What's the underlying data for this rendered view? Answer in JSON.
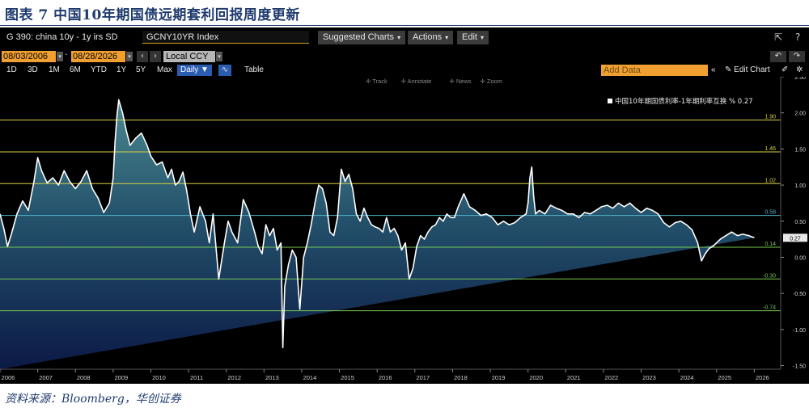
{
  "caption": "图表 7 中国10年期国债远期套利回报周度更新",
  "source": "资料来源：Bloomberg，华创证券",
  "toolbar": {
    "ticker": "G 390: china 10y - 1y irs SD",
    "security": "GCNY10YR Index",
    "suggested_charts": "Suggested Charts",
    "actions": "Actions",
    "edit": "Edit",
    "export_icon": "export-icon",
    "help_icon": "help-icon"
  },
  "range": {
    "start_date": "08/03/2006",
    "end_date": "08/28/2026",
    "currency": "Local CCY"
  },
  "periods": [
    "1D",
    "3D",
    "1M",
    "6M",
    "YTD",
    "1Y",
    "5Y",
    "Max"
  ],
  "frequency": "Daily",
  "table_label": "Table",
  "add_data_placeholder": "Add Data",
  "edit_chart": "Edit Chart",
  "tools": [
    "Track",
    "Annotate",
    "News",
    "Zoom"
  ],
  "colors": {
    "accent": "#f0a030",
    "series": "#ffffff",
    "high_lines": "#d8d040",
    "mid_line": "#50b8d0",
    "low_lines": "#78c850"
  },
  "chart_data": {
    "type": "area",
    "legend": "中国10年期国债利率-1年期利率互换 % 0.27",
    "last_value": 0.27,
    "ylim": [
      -1.55,
      2.5
    ],
    "yticks": [
      -1.5,
      -1.0,
      -0.5,
      0.0,
      0.5,
      1.0,
      1.5,
      2.0,
      2.5
    ],
    "ytick_labels": [
      "-1.50",
      "-1.00",
      "-0.50",
      "0.00",
      "0.50",
      "1.00",
      "1.50",
      "2.00",
      "2.50"
    ],
    "xlim": [
      2006.0,
      2026.7
    ],
    "xticks": [
      "2006",
      "2007",
      "2008",
      "2009",
      "2010",
      "2011",
      "2012",
      "2013",
      "2014",
      "2015",
      "2016",
      "2017",
      "2018",
      "2019",
      "2020",
      "2021",
      "2022",
      "2023",
      "2024",
      "2025",
      "2026"
    ],
    "hlines": [
      {
        "value": 1.9,
        "label": "1.90",
        "color": "#d8d040"
      },
      {
        "value": 1.46,
        "label": "1.46",
        "color": "#d8d040"
      },
      {
        "value": 1.02,
        "label": "1.02",
        "color": "#d8d040"
      },
      {
        "value": 0.58,
        "label": "0.58",
        "color": "#50b8d0"
      },
      {
        "value": 0.14,
        "label": "0.14",
        "color": "#78c850"
      },
      {
        "value": -0.3,
        "label": "-0.30",
        "color": "#78c850"
      },
      {
        "value": -0.74,
        "label": "-0.74",
        "color": "#78c850"
      }
    ],
    "x": [
      2006.0,
      2006.1,
      2006.2,
      2006.3,
      2006.45,
      2006.6,
      2006.75,
      2006.9,
      2007.0,
      2007.1,
      2007.25,
      2007.4,
      2007.55,
      2007.7,
      2007.85,
      2008.0,
      2008.15,
      2008.3,
      2008.45,
      2008.6,
      2008.75,
      2008.9,
      2009.0,
      2009.05,
      2009.1,
      2009.15,
      2009.25,
      2009.35,
      2009.45,
      2009.6,
      2009.75,
      2009.9,
      2010.0,
      2010.15,
      2010.3,
      2010.45,
      2010.55,
      2010.65,
      2010.75,
      2010.85,
      2010.95,
      2011.05,
      2011.15,
      2011.3,
      2011.45,
      2011.55,
      2011.65,
      2011.8,
      2011.95,
      2012.05,
      2012.15,
      2012.3,
      2012.45,
      2012.6,
      2012.75,
      2012.85,
      2012.95,
      2013.05,
      2013.15,
      2013.25,
      2013.35,
      2013.45,
      2013.5,
      2013.55,
      2013.65,
      2013.75,
      2013.85,
      2013.95,
      2014.05,
      2014.15,
      2014.25,
      2014.35,
      2014.45,
      2014.55,
      2014.65,
      2014.75,
      2014.85,
      2014.95,
      2015.05,
      2015.15,
      2015.25,
      2015.35,
      2015.45,
      2015.55,
      2015.65,
      2015.75,
      2015.85,
      2015.95,
      2016.05,
      2016.15,
      2016.25,
      2016.35,
      2016.45,
      2016.55,
      2016.65,
      2016.75,
      2016.85,
      2016.95,
      2017.05,
      2017.15,
      2017.25,
      2017.35,
      2017.45,
      2017.55,
      2017.65,
      2017.75,
      2017.85,
      2017.95,
      2018.05,
      2018.15,
      2018.3,
      2018.45,
      2018.6,
      2018.75,
      2018.9,
      2019.05,
      2019.2,
      2019.35,
      2019.5,
      2019.65,
      2019.8,
      2019.95,
      2020.0,
      2020.05,
      2020.1,
      2020.15,
      2020.2,
      2020.3,
      2020.45,
      2020.6,
      2020.75,
      2020.9,
      2021.05,
      2021.2,
      2021.35,
      2021.5,
      2021.65,
      2021.8,
      2021.95,
      2022.1,
      2022.25,
      2022.4,
      2022.55,
      2022.7,
      2022.85,
      2023.0,
      2023.15,
      2023.3,
      2023.45,
      2023.6,
      2023.75,
      2023.9,
      2024.05,
      2024.2,
      2024.35,
      2024.5,
      2024.6,
      2024.7,
      2024.8,
      2024.9,
      2025.0,
      2025.1,
      2025.25,
      2025.4,
      2025.55,
      2025.7,
      2025.85,
      2026.0,
      2026.15,
      2026.3,
      2026.45,
      2026.6
    ],
    "values": [
      0.6,
      0.4,
      0.15,
      0.32,
      0.6,
      0.78,
      0.65,
      1.05,
      1.38,
      1.2,
      1.03,
      1.1,
      1.0,
      1.2,
      1.05,
      0.95,
      1.05,
      1.2,
      0.95,
      0.82,
      0.62,
      0.75,
      1.1,
      1.6,
      1.95,
      2.18,
      2.0,
      1.75,
      1.55,
      1.65,
      1.72,
      1.55,
      1.4,
      1.28,
      1.32,
      1.1,
      1.22,
      1.0,
      1.05,
      1.18,
      0.92,
      0.6,
      0.35,
      0.7,
      0.5,
      0.2,
      0.6,
      -0.3,
      0.2,
      0.5,
      0.35,
      0.2,
      0.8,
      0.62,
      0.35,
      0.15,
      0.05,
      0.45,
      0.3,
      0.4,
      0.1,
      0.2,
      -1.25,
      -0.4,
      -0.1,
      0.1,
      0.0,
      -0.72,
      0.0,
      0.2,
      0.45,
      0.75,
      1.0,
      0.95,
      0.75,
      0.35,
      0.3,
      0.55,
      1.22,
      1.05,
      1.15,
      0.95,
      0.6,
      0.5,
      0.68,
      0.55,
      0.45,
      0.42,
      0.4,
      0.35,
      0.55,
      0.35,
      0.4,
      0.3,
      0.1,
      0.2,
      -0.3,
      -0.15,
      0.15,
      0.3,
      0.25,
      0.35,
      0.42,
      0.45,
      0.55,
      0.5,
      0.6,
      0.55,
      0.55,
      0.7,
      0.88,
      0.7,
      0.65,
      0.58,
      0.6,
      0.55,
      0.45,
      0.5,
      0.45,
      0.48,
      0.55,
      0.6,
      0.75,
      1.1,
      1.25,
      0.85,
      0.6,
      0.65,
      0.6,
      0.72,
      0.68,
      0.65,
      0.6,
      0.6,
      0.55,
      0.62,
      0.6,
      0.65,
      0.7,
      0.72,
      0.68,
      0.75,
      0.7,
      0.75,
      0.68,
      0.62,
      0.68,
      0.65,
      0.6,
      0.48,
      0.42,
      0.48,
      0.5,
      0.45,
      0.38,
      0.2,
      -0.05,
      0.05,
      0.12,
      0.15,
      0.2,
      0.25,
      0.3,
      0.35,
      0.3,
      0.32,
      0.3,
      0.27
    ]
  }
}
